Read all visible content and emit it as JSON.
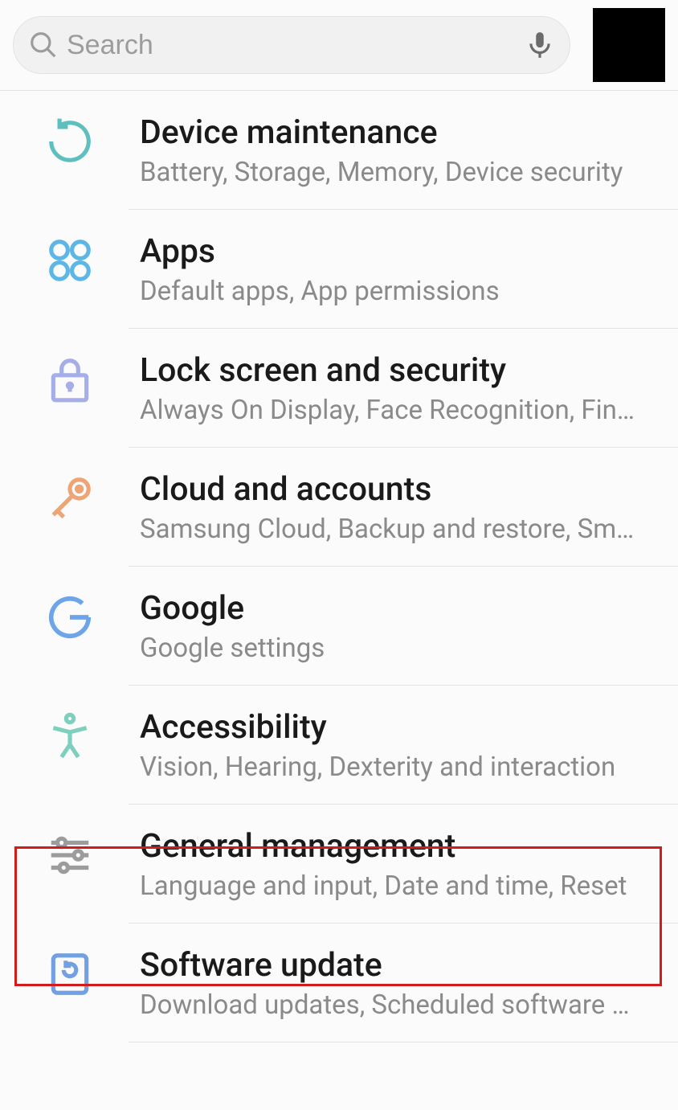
{
  "search": {
    "placeholder": "Search"
  },
  "items": [
    {
      "title": "Device maintenance",
      "subtitle": "Battery, Storage, Memory, Device security"
    },
    {
      "title": "Apps",
      "subtitle": "Default apps, App permissions"
    },
    {
      "title": "Lock screen and security",
      "subtitle": "Always On Display, Face Recognition, Finge…"
    },
    {
      "title": "Cloud and accounts",
      "subtitle": "Samsung Cloud, Backup and restore, Smart…"
    },
    {
      "title": "Google",
      "subtitle": "Google settings"
    },
    {
      "title": "Accessibility",
      "subtitle": "Vision, Hearing, Dexterity and interaction"
    },
    {
      "title": "General management",
      "subtitle": "Language and input, Date and time, Reset"
    },
    {
      "title": "Software update",
      "subtitle": "Download updates, Scheduled software up…"
    }
  ]
}
